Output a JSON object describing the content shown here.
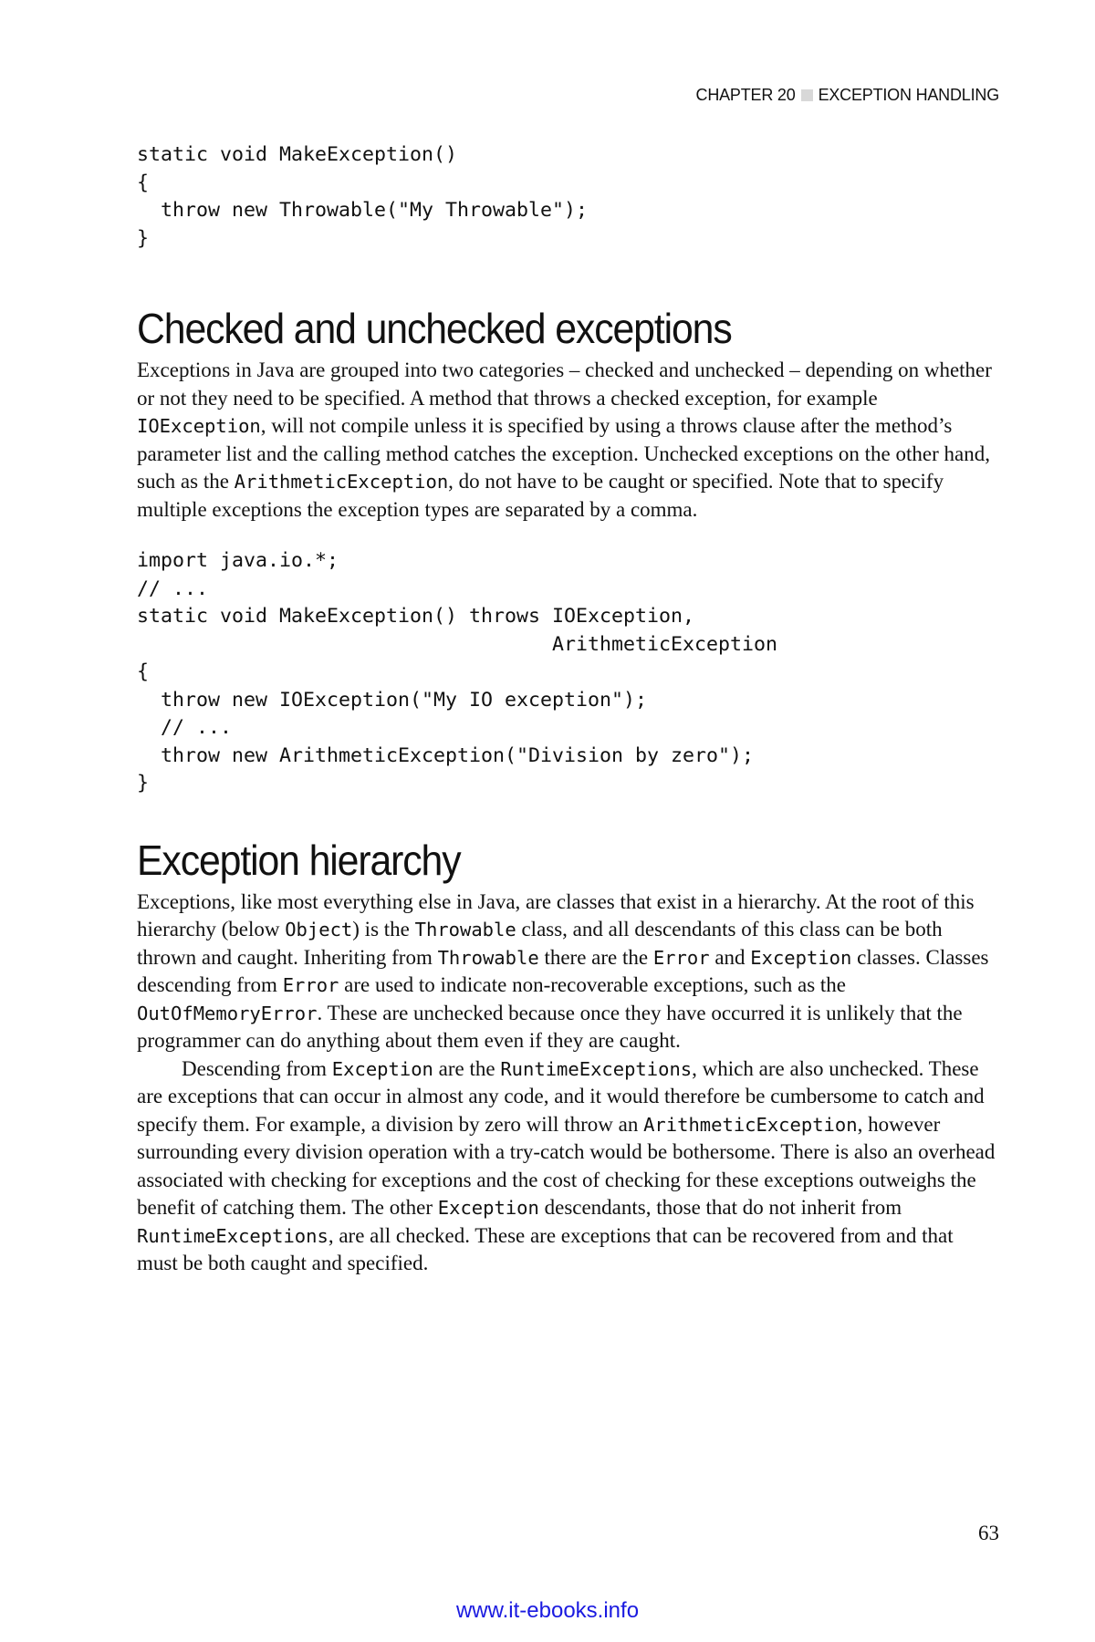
{
  "header": {
    "chapter": "CHAPTER 20",
    "title": "EXCEPTION HANDLING"
  },
  "code_block_1": "static void MakeException()\n{\n  throw new Throwable(\"My Throwable\");\n}",
  "section_1": {
    "heading": "Checked and unchecked exceptions",
    "para_1": {
      "t1": "Exceptions in Java are grouped into two categories – checked and unchecked – depending on whether or not they need to be specified. A method that throws a checked exception, for example ",
      "c1": "IOException",
      "t2": ", will not compile unless it is specified by using a throws clause after the method’s parameter list and the calling method catches the exception. Unchecked exceptions on the other hand, such as the ",
      "c2": "ArithmeticException",
      "t3": ", do not have to be caught or specified. Note that to specify multiple exceptions the exception types are separated by a comma."
    }
  },
  "code_block_2": "import java.io.*;\n// ...\nstatic void MakeException() throws IOException,\n                                   ArithmeticException\n{\n  throw new IOException(\"My IO exception\");\n  // ...\n  throw new ArithmeticException(\"Division by zero\");\n}",
  "section_2": {
    "heading": "Exception hierarchy",
    "para_1": {
      "t1": "Exceptions, like most everything else in Java, are classes that exist in a hierarchy. At the root of this hierarchy (below ",
      "c1": "Object",
      "t2": ") is the ",
      "c2": "Throwable",
      "t3": " class, and all descendants of this class can be both thrown and caught. Inheriting from ",
      "c3": "Throwable",
      "t4": " there are the ",
      "c4": "Error",
      "t5": " and ",
      "c5": "Exception",
      "t6": " classes. Classes descending from ",
      "c6": "Error",
      "t7": " are used to indicate non-recoverable exceptions, such as the ",
      "c7": "OutOfMemoryError",
      "t8": ". These are unchecked because once they have occurred it is unlikely that the programmer can do anything about them even if they are caught."
    },
    "para_2": {
      "t1": "Descending from ",
      "c1": "Exception",
      "t2": " are the ",
      "c2": "RuntimeExceptions",
      "t3": ", which are also unchecked. These are exceptions that can occur in almost any code, and it would therefore be cumbersome to catch and specify them. For example, a division by zero will throw an ",
      "c3": "ArithmeticException",
      "t4": ", however surrounding every division operation with a try-catch would be bothersome. There is also an overhead associated with checking for exceptions and the cost of checking for these exceptions outweighs the benefit of catching them. The other ",
      "c4": "Exception",
      "t5": " descendants, those that do not inherit from ",
      "c5": "RuntimeExceptions",
      "t6": ", are all checked. These are exceptions that can be recovered from and that must be both caught and specified."
    }
  },
  "page_number": "63",
  "footer_link": "www.it-ebooks.info"
}
